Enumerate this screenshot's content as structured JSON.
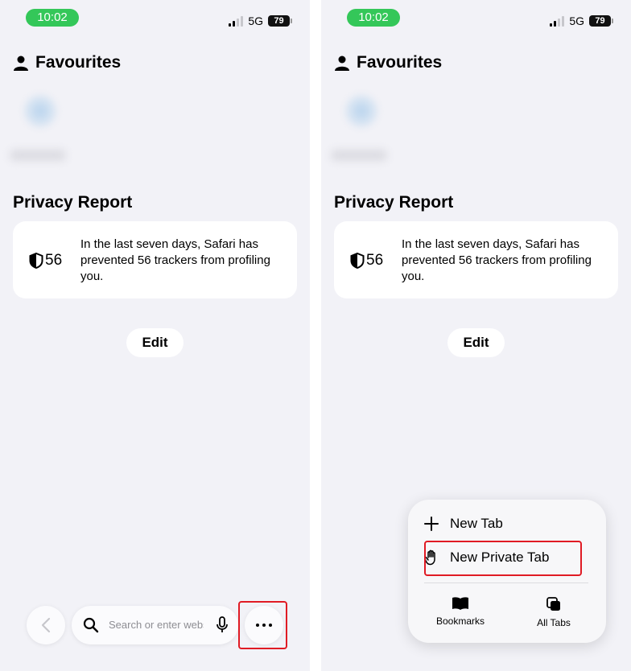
{
  "status_bar": {
    "time": "10:02",
    "network": "5G",
    "battery": "79"
  },
  "favourites": {
    "title": "Favourites"
  },
  "privacy": {
    "title": "Privacy Report",
    "count": "56",
    "message": "In the last seven days, Safari has prevented 56 trackers from profiling you."
  },
  "edit_label": "Edit",
  "toolbar": {
    "search_placeholder": "Search or enter website name"
  },
  "menu": {
    "new_tab": "New Tab",
    "new_private_tab": "New Private Tab",
    "bookmarks": "Bookmarks",
    "all_tabs": "All Tabs"
  },
  "colors": {
    "time_pill": "#34c759",
    "highlight": "#e01b24",
    "background": "#f2f2f7"
  },
  "icons": [
    "person-icon",
    "shield-icon",
    "back-chevron-icon",
    "search-icon",
    "microphone-icon",
    "more-icon",
    "plus-icon",
    "hand-icon",
    "book-icon",
    "tabs-icon"
  ]
}
